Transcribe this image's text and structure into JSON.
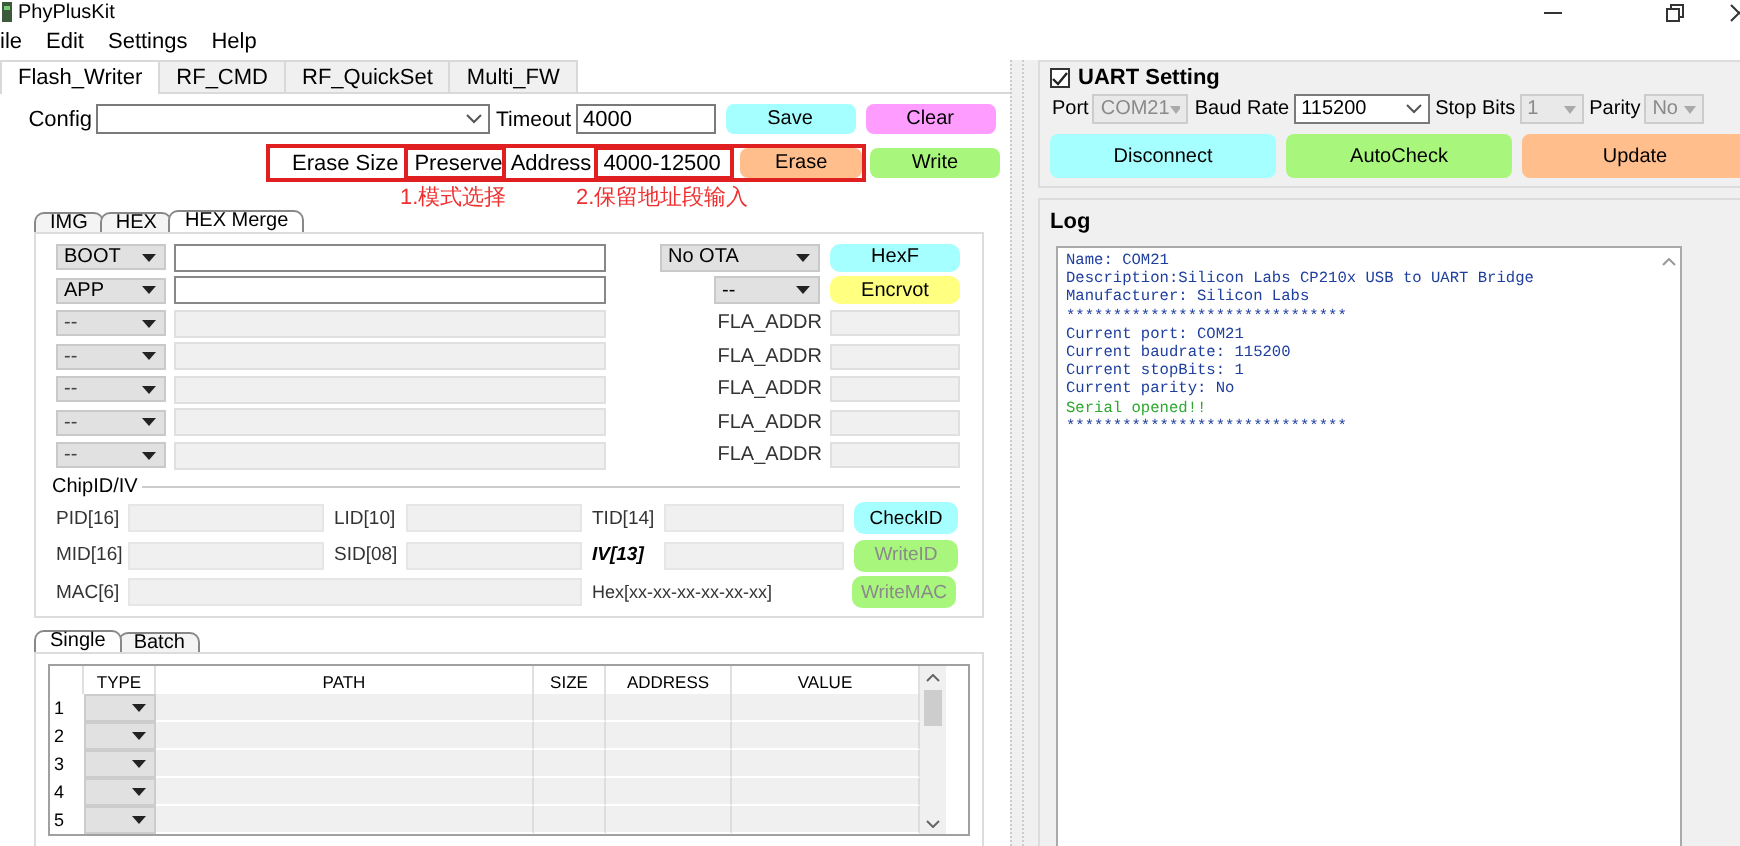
{
  "window": {
    "title": "PhyPlusKit"
  },
  "menu": [
    "ile",
    "Edit",
    "Settings",
    "Help"
  ],
  "tabs": [
    {
      "label": "Flash_Writer",
      "selected": true
    },
    {
      "label": "RF_CMD",
      "selected": false
    },
    {
      "label": "RF_QuickSet",
      "selected": false
    },
    {
      "label": "Multi_FW",
      "selected": false
    }
  ],
  "config": {
    "label": "Config",
    "timeout_label": "Timeout",
    "timeout": "4000"
  },
  "top_buttons": [
    {
      "label": "Save",
      "color": "#a6ffff"
    },
    {
      "label": "Clear",
      "color": "#ff9cff"
    }
  ],
  "erase": {
    "label": "Erase Size",
    "mode": "Preserve",
    "address_label": "Address",
    "address": "4000-12500",
    "highlighted": true,
    "button": {
      "label": "Erase",
      "color": "#ffbe8c"
    }
  },
  "write_button": {
    "label": "Write",
    "color": "#a8f77c"
  },
  "annotations": [
    "1.模式选择",
    "2.保留地址段输入"
  ],
  "sub_tabs": [
    {
      "label": "IMG",
      "selected": false
    },
    {
      "label": "HEX",
      "selected": false
    },
    {
      "label": "HEX Merge",
      "selected": true
    }
  ],
  "hex_rows": [
    {
      "kind": "select",
      "type": "BOOT",
      "enabled": true,
      "option": "No OTA",
      "button": {
        "label": "HexF",
        "color": "#a6ffff"
      }
    },
    {
      "kind": "select",
      "type": "APP",
      "enabled": true,
      "option": "--",
      "button": {
        "label": "Encrvot",
        "color": "#ffff80"
      }
    },
    {
      "kind": "address",
      "type": "--",
      "enabled": false,
      "label": "FLA_ADDR"
    },
    {
      "kind": "address",
      "type": "--",
      "enabled": false,
      "label": "FLA_ADDR"
    },
    {
      "kind": "address",
      "type": "--",
      "enabled": false,
      "label": "FLA_ADDR"
    },
    {
      "kind": "address",
      "type": "--",
      "enabled": false,
      "label": "FLA_ADDR"
    },
    {
      "kind": "address",
      "type": "--",
      "enabled": false,
      "label": "FLA_ADDR"
    }
  ],
  "chip_id": {
    "title": "ChipID/IV",
    "rows": [
      {
        "kind": "ids",
        "fields": [
          {
            "label": "PID[16]",
            "emphasized": false
          },
          {
            "label": "LID[10]",
            "emphasized": false
          },
          {
            "label": "TID[14]",
            "emphasized": false
          }
        ],
        "button": {
          "label": "CheckID",
          "disabled": false,
          "color": "#a6ffff"
        }
      },
      {
        "kind": "ids",
        "fields": [
          {
            "label": "MID[16]",
            "emphasized": false
          },
          {
            "label": "SID[08]",
            "emphasized": false
          },
          {
            "label": "IV[13]",
            "emphasized": true
          }
        ],
        "button": {
          "label": "WriteID",
          "disabled": true,
          "color": "#a8f77c"
        }
      },
      {
        "kind": "mac",
        "fields": [
          {
            "label": "MAC[6]",
            "emphasized": false
          }
        ],
        "hint": "Hex[xx-xx-xx-xx-xx-xx]",
        "button": {
          "label": "WriteMAC",
          "disabled": true,
          "color": "#a8f77c"
        }
      }
    ]
  },
  "table_tabs": [
    {
      "label": "Single",
      "selected": true
    },
    {
      "label": "Batch",
      "selected": false
    }
  ],
  "table": {
    "columns": [
      "TYPE",
      "PATH",
      "SIZE",
      "ADDRESS",
      "VALUE"
    ],
    "rows": [
      "1",
      "2",
      "3",
      "4",
      "5"
    ]
  },
  "uart": {
    "title": "UART Setting",
    "checked": true,
    "fields": [
      {
        "label": "Port",
        "value": "COM21",
        "disabled": true
      },
      {
        "label": "Baud Rate",
        "value": "115200",
        "disabled": false
      },
      {
        "label": "Stop Bits",
        "value": "1",
        "disabled": true
      },
      {
        "label": "Parity",
        "value": "No",
        "disabled": true
      }
    ],
    "buttons": [
      {
        "label": "Disconnect",
        "color": "#a6ffff"
      },
      {
        "label": "AutoCheck",
        "color": "#a8f77c"
      },
      {
        "label": "Update",
        "color": "#ffbe8c"
      }
    ]
  },
  "log": {
    "title": "Log",
    "lines": [
      {
        "text": "Name: COM21",
        "kind": "info"
      },
      {
        "text": "Description:Silicon Labs CP210x USB to UART Bridge",
        "kind": "info"
      },
      {
        "text": "Manufacturer: Silicon Labs",
        "kind": "info"
      },
      {
        "text": "******************************",
        "kind": "info"
      },
      {
        "text": "Current port: COM21",
        "kind": "info"
      },
      {
        "text": "Current baudrate: 115200",
        "kind": "info"
      },
      {
        "text": "Current stopBits: 1",
        "kind": "info"
      },
      {
        "text": "Current parity: No",
        "kind": "info"
      },
      {
        "text": "Serial opened!!",
        "kind": "success"
      },
      {
        "text": "******************************",
        "kind": "info"
      }
    ]
  }
}
